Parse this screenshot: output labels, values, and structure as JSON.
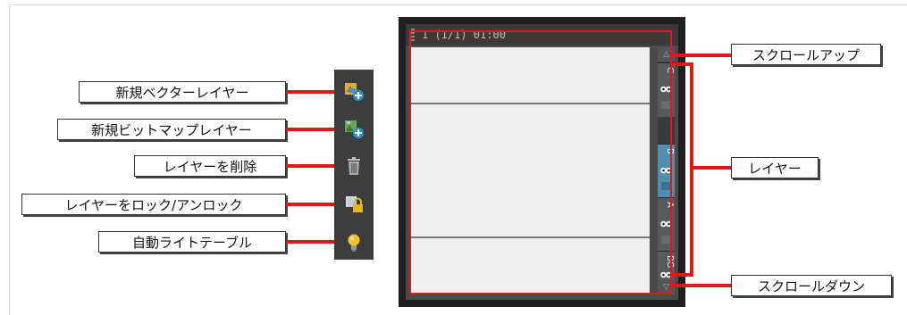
{
  "left_callouts": [
    {
      "id": "new-vector-layer",
      "label": "新規ベクターレイヤー"
    },
    {
      "id": "new-bitmap-layer",
      "label": "新規ビットマップレイヤー"
    },
    {
      "id": "delete-layer",
      "label": "レイヤーを削除"
    },
    {
      "id": "lock-unlock-layer",
      "label": "レイヤーをロック/アンロック"
    },
    {
      "id": "auto-light-table",
      "label": "自動ライトテーブル"
    }
  ],
  "right_callouts": {
    "scroll_up": "スクロールアップ",
    "layers": "レイヤー",
    "scroll_down": "スクロールダウン"
  },
  "panel": {
    "title": "1 (1/1) 01:00",
    "layers": [
      {
        "name": "C",
        "active": false
      },
      {
        "name": "B",
        "active": true
      },
      {
        "name": "A",
        "active": false
      },
      {
        "name": "BG",
        "active": false
      }
    ]
  },
  "toolbar_icons": [
    "new-vector-layer-icon",
    "new-bitmap-layer-icon",
    "trash-icon",
    "lock-layer-icon",
    "lightbulb-icon"
  ],
  "colors": {
    "accent_red": "#e01818",
    "active_layer": "#4f8fb0",
    "panel_bg": "#202020"
  }
}
